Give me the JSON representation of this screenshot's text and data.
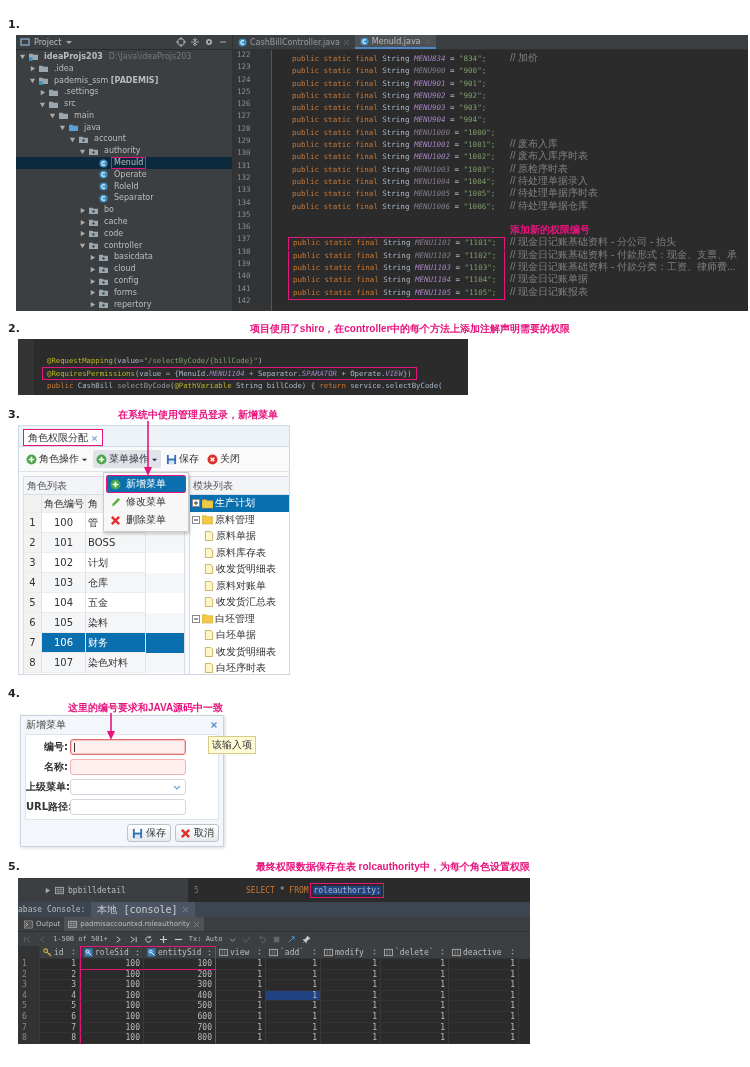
{
  "step_1": {
    "label": "1.",
    "project_panel": {
      "title": "Project",
      "tree": [
        {
          "label": "ideaProjs203",
          "path": "D:\\Java\\ideaProjs203",
          "kind": "project",
          "expanded": true,
          "selected": false,
          "children": [
            {
              "label": ".idea",
              "kind": "folder",
              "expanded": false,
              "selected": false
            },
            {
              "label": "pademis_ssm **[PADEMIS]**",
              "kind": "project",
              "expanded": true,
              "selected": false,
              "children": [
                {
                  "label": ".settings",
                  "kind": "folder",
                  "expanded": false,
                  "selected": false
                },
                {
                  "label": "src",
                  "kind": "folder",
                  "expanded": true,
                  "selected": false,
                  "children": [
                    {
                      "label": "main",
                      "kind": "folder",
                      "expanded": true,
                      "selected": false,
                      "children": [
                        {
                          "label": "java",
                          "kind": "source",
                          "expanded": true,
                          "selected": false,
                          "children": [
                            {
                              "label": "account",
                              "kind": "package",
                              "expanded": true,
                              "selected": false,
                              "children": [
                                {
                                  "label": "authority",
                                  "kind": "package",
                                  "expanded": true,
                                  "selected": false,
                                  "children": [
                                    {
                                      "label": "MenuId",
                                      "kind": "class",
                                      "selected": true,
                                      "highlighted": true
                                    },
                                    {
                                      "label": "Operate",
                                      "kind": "class",
                                      "selected": false,
                                      "highlighted": false
                                    },
                                    {
                                      "label": "RoleId",
                                      "kind": "class",
                                      "selected": false,
                                      "highlighted": false
                                    },
                                    {
                                      "label": "Separator",
                                      "kind": "class",
                                      "selected": false,
                                      "highlighted": false
                                    }
                                  ]
                                },
                                {
                                  "label": "bo",
                                  "kind": "package",
                                  "expanded": false,
                                  "selected": false
                                },
                                {
                                  "label": "cache",
                                  "kind": "package",
                                  "expanded": false,
                                  "selected": false
                                },
                                {
                                  "label": "code",
                                  "kind": "package",
                                  "expanded": false,
                                  "selected": false
                                },
                                {
                                  "label": "controller",
                                  "kind": "package",
                                  "expanded": true,
                                  "selected": false,
                                  "children": [
                                    {
                                      "label": "basicdata",
                                      "kind": "package",
                                      "expanded": false,
                                      "selected": false
                                    },
                                    {
                                      "label": "cloud",
                                      "kind": "package",
                                      "expanded": false,
                                      "selected": false
                                    },
                                    {
                                      "label": "config",
                                      "kind": "package",
                                      "expanded": false,
                                      "selected": false
                                    },
                                    {
                                      "label": "forms",
                                      "kind": "package",
                                      "expanded": false,
                                      "selected": false
                                    },
                                    {
                                      "label": "repertory",
                                      "kind": "package",
                                      "expanded": false,
                                      "selected": false
                                    }
                                  ]
                                }
                              ]
                            }
                          ]
                        }
                      ]
                    }
                  ]
                }
              ]
            }
          ]
        }
      ]
    },
    "editor": {
      "tabs": [
        {
          "label": "CashBillController.java",
          "selected": false
        },
        {
          "label": "MenuId.java",
          "selected": true
        }
      ],
      "lines": [
        {
          "number": "122",
          "boxed": false,
          "tokens": [
            {
              "kind": "kw",
              "text": "public static final "
            },
            {
              "kind": "ty",
              "text": "String "
            },
            {
              "kind": "co",
              "text": "MENU834"
            },
            {
              "kind": "pl",
              "text": " = "
            },
            {
              "kind": "st",
              "text": "\"834\";"
            }
          ],
          "comment": "//  加价"
        },
        {
          "number": "123",
          "boxed": false,
          "tokens": [
            {
              "kind": "kw",
              "text": "public static final "
            },
            {
              "kind": "ty",
              "text": "String "
            },
            {
              "kind": "cg",
              "text": "MENU900"
            },
            {
              "kind": "pl",
              "text": " = "
            },
            {
              "kind": "st",
              "text": "\"900\";"
            }
          ]
        },
        {
          "number": "124",
          "boxed": false,
          "tokens": [
            {
              "kind": "kw",
              "text": "public static final "
            },
            {
              "kind": "ty",
              "text": "String "
            },
            {
              "kind": "co",
              "text": "MENU901"
            },
            {
              "kind": "pl",
              "text": " = "
            },
            {
              "kind": "st",
              "text": "\"901\";"
            }
          ]
        },
        {
          "number": "125",
          "boxed": false,
          "tokens": [
            {
              "kind": "kw",
              "text": "public static final "
            },
            {
              "kind": "ty",
              "text": "String "
            },
            {
              "kind": "co",
              "text": "MENU902"
            },
            {
              "kind": "pl",
              "text": " = "
            },
            {
              "kind": "st",
              "text": "\"902\";"
            }
          ]
        },
        {
          "number": "126",
          "boxed": false,
          "tokens": [
            {
              "kind": "kw",
              "text": "public static final "
            },
            {
              "kind": "ty",
              "text": "String "
            },
            {
              "kind": "co",
              "text": "MENU903"
            },
            {
              "kind": "pl",
              "text": " = "
            },
            {
              "kind": "st",
              "text": "\"903\";"
            }
          ]
        },
        {
          "number": "127",
          "boxed": false,
          "tokens": [
            {
              "kind": "kw",
              "text": "public static final "
            },
            {
              "kind": "ty",
              "text": "String "
            },
            {
              "kind": "co",
              "text": "MENU904"
            },
            {
              "kind": "pl",
              "text": " = "
            },
            {
              "kind": "st",
              "text": "\"904\";"
            }
          ]
        },
        {
          "number": "128",
          "boxed": false,
          "tokens": [
            {
              "kind": "kw",
              "text": "public static final "
            },
            {
              "kind": "ty",
              "text": "String "
            },
            {
              "kind": "cg",
              "text": "MENU1000"
            },
            {
              "kind": "pl",
              "text": " = "
            },
            {
              "kind": "st",
              "text": "\"1000\";"
            }
          ]
        },
        {
          "number": "129",
          "boxed": false,
          "tokens": [
            {
              "kind": "kw",
              "text": "public static final "
            },
            {
              "kind": "ty",
              "text": "String "
            },
            {
              "kind": "co",
              "text": "MENU1001"
            },
            {
              "kind": "pl",
              "text": " = "
            },
            {
              "kind": "st",
              "text": "\"1001\";"
            }
          ],
          "comment": "// 废布入库"
        },
        {
          "number": "130",
          "boxed": false,
          "tokens": [
            {
              "kind": "kw",
              "text": "public static final "
            },
            {
              "kind": "ty",
              "text": "String "
            },
            {
              "kind": "co",
              "text": "MENU1002"
            },
            {
              "kind": "pl",
              "text": " = "
            },
            {
              "kind": "st",
              "text": "\"1002\";"
            }
          ],
          "comment": "// 废布入库序时表"
        },
        {
          "number": "131",
          "boxed": false,
          "tokens": [
            {
              "kind": "kw",
              "text": "public static final "
            },
            {
              "kind": "ty",
              "text": "String "
            },
            {
              "kind": "cg",
              "text": "MENU1003"
            },
            {
              "kind": "pl",
              "text": " = "
            },
            {
              "kind": "st",
              "text": "\"1003\";"
            }
          ],
          "comment": "// 原检序时表"
        },
        {
          "number": "132",
          "boxed": false,
          "tokens": [
            {
              "kind": "kw",
              "text": "public static final "
            },
            {
              "kind": "ty",
              "text": "String "
            },
            {
              "kind": "cg",
              "text": "MENU1004"
            },
            {
              "kind": "pl",
              "text": " = "
            },
            {
              "kind": "st",
              "text": "\"1004\";"
            }
          ],
          "comment": "// 待处理单据录入"
        },
        {
          "number": "133",
          "boxed": false,
          "tokens": [
            {
              "kind": "kw",
              "text": "public static final "
            },
            {
              "kind": "ty",
              "text": "String "
            },
            {
              "kind": "cg",
              "text": "MENU1005"
            },
            {
              "kind": "pl",
              "text": " = "
            },
            {
              "kind": "st",
              "text": "\"1005\";"
            }
          ],
          "comment": "// 待处理单据序时表"
        },
        {
          "number": "134",
          "boxed": false,
          "tokens": [
            {
              "kind": "kw",
              "text": "public static final "
            },
            {
              "kind": "ty",
              "text": "String "
            },
            {
              "kind": "cg",
              "text": "MENU1006"
            },
            {
              "kind": "pl",
              "text": " = "
            },
            {
              "kind": "st",
              "text": "\"1006\";"
            }
          ],
          "comment": "// 待处理单据仓库"
        },
        {
          "number": "135"
        },
        {
          "number": "136",
          "note": "添加新的权限编号"
        },
        {
          "number": "137",
          "boxed": true,
          "tokens": [
            {
              "kind": "kw",
              "text": "public static final "
            },
            {
              "kind": "ty",
              "text": "String "
            },
            {
              "kind": "cg",
              "text": "MENU1101"
            },
            {
              "kind": "pl",
              "text": " = "
            },
            {
              "kind": "st",
              "text": "\"1101\";"
            }
          ],
          "comment": "// 现金日记账基础资料 - 分公司 - 抬头"
        },
        {
          "number": "138",
          "boxed": true,
          "tokens": [
            {
              "kind": "kw",
              "text": "public static final "
            },
            {
              "kind": "ty",
              "text": "String "
            },
            {
              "kind": "cg",
              "text": "MENU1102"
            },
            {
              "kind": "pl",
              "text": " = "
            },
            {
              "kind": "st",
              "text": "\"1102\";"
            }
          ],
          "comment": "// 现金日记账基础资料 - 付款形式：现金、支票、承"
        },
        {
          "number": "139",
          "boxed": true,
          "tokens": [
            {
              "kind": "kw",
              "text": "public static final "
            },
            {
              "kind": "ty",
              "text": "String "
            },
            {
              "kind": "co",
              "text": "MENU1103"
            },
            {
              "kind": "pl",
              "text": " = "
            },
            {
              "kind": "st",
              "text": "\"1103\";"
            }
          ],
          "comment": "// 现金日记账基础资料 - 付款分类：工资、律师费..."
        },
        {
          "number": "140",
          "boxed": true,
          "tokens": [
            {
              "kind": "kw",
              "text": "public static final "
            },
            {
              "kind": "ty",
              "text": "String "
            },
            {
              "kind": "co",
              "text": "MENU1104"
            },
            {
              "kind": "pl",
              "text": " = "
            },
            {
              "kind": "st",
              "text": "\"1104\";"
            }
          ],
          "comment": "// 现金日记账单据"
        },
        {
          "number": "141",
          "boxed": true,
          "tokens": [
            {
              "kind": "kw",
              "text": "public static final "
            },
            {
              "kind": "ty",
              "text": "String "
            },
            {
              "kind": "co",
              "text": "MENU1105"
            },
            {
              "kind": "pl",
              "text": " = "
            },
            {
              "kind": "st",
              "text": "\"1105\";"
            }
          ],
          "comment": "// 现金日记账报表"
        },
        {
          "number": "142"
        }
      ]
    }
  },
  "step_2": {
    "label": "2.",
    "annotation": "项目使用了shiro，在controller中的每个方法上添加注解声明需要的权限",
    "lines": [
      {
        "boxed": false,
        "tokens": [
          {
            "kind": "an",
            "text": "@RequestMapping"
          },
          {
            "kind": "pl",
            "text": "(value="
          },
          {
            "kind": "st",
            "text": "\"/selectByCode/{billCode}\""
          },
          {
            "kind": "pl",
            "text": ")"
          }
        ]
      },
      {
        "boxed": true,
        "tokens": [
          {
            "kind": "an",
            "text": "@RequiresPermissions"
          },
          {
            "kind": "pl",
            "text": "(value = {MenuId."
          },
          {
            "kind": "co",
            "text": "MENU1104"
          },
          {
            "kind": "pl",
            "text": " + Separator."
          },
          {
            "kind": "co",
            "text": "SPARATOR"
          },
          {
            "kind": "pl",
            "text": " + Operate."
          },
          {
            "kind": "co",
            "text": "VIEW"
          },
          {
            "kind": "pl",
            "text": "})"
          }
        ]
      },
      {
        "boxed": false,
        "tokens": [
          {
            "kind": "kw",
            "text": "public "
          },
          {
            "kind": "pl",
            "text": "CashBill "
          },
          {
            "kind": "fn",
            "text": "selectByCode"
          },
          {
            "kind": "pl",
            "text": "("
          },
          {
            "kind": "an",
            "text": "@PathVariable"
          },
          {
            "kind": "pl",
            "text": " String billCode) { "
          },
          {
            "kind": "kw",
            "text": "return "
          },
          {
            "kind": "pl",
            "text": "service.selectByCode("
          }
        ]
      }
    ]
  },
  "step_3": {
    "label": "3.",
    "annotation": "在系统中使用管理员登录，新增菜单",
    "tab": {
      "label": "角色权限分配",
      "highlighted": true
    },
    "toolbar": [
      {
        "label": "角色操作",
        "kind": "add",
        "dropdown": true,
        "pressed": false
      },
      {
        "label": "菜单操作",
        "kind": "add",
        "dropdown": true,
        "pressed": true
      },
      {
        "label": "保存",
        "kind": "save",
        "dropdown": false,
        "pressed": false
      },
      {
        "label": "关闭",
        "kind": "close",
        "dropdown": false,
        "pressed": false
      }
    ],
    "menu": [
      {
        "label": "新增菜单",
        "kind": "add",
        "selected": true,
        "highlighted": true
      },
      {
        "label": "修改菜单",
        "kind": "edit",
        "selected": false,
        "highlighted": false
      },
      {
        "label": "删除菜单",
        "kind": "delete",
        "selected": false,
        "highlighted": false
      }
    ],
    "role_panel": {
      "title": "角色列表",
      "columns": [
        "角色编号",
        "角"
      ],
      "rows": [
        {
          "number": "1",
          "code": "100",
          "name": "管",
          "selected": false
        },
        {
          "number": "2",
          "code": "101",
          "name": "BOSS",
          "selected": false
        },
        {
          "number": "3",
          "code": "102",
          "name": "计划",
          "selected": false
        },
        {
          "number": "4",
          "code": "103",
          "name": "仓库",
          "selected": false
        },
        {
          "number": "5",
          "code": "104",
          "name": "五金",
          "selected": false
        },
        {
          "number": "6",
          "code": "105",
          "name": "染料",
          "selected": false
        },
        {
          "number": "7",
          "code": "106",
          "name": "财务",
          "selected": true
        },
        {
          "number": "8",
          "code": "107",
          "name": "染色对料",
          "selected": false
        }
      ]
    },
    "module_panel": {
      "title": "模块列表",
      "tree": [
        {
          "label": "生产计划",
          "expanded": false,
          "selected": true
        },
        {
          "label": "原料管理",
          "expanded": true,
          "selected": false,
          "children": [
            {
              "label": "原料单据",
              "selected": false
            },
            {
              "label": "原料库存表",
              "selected": false
            },
            {
              "label": "收发货明细表",
              "selected": false
            },
            {
              "label": "原料对账单",
              "selected": false
            },
            {
              "label": "收发货汇总表",
              "selected": false
            }
          ]
        },
        {
          "label": "白坯管理",
          "expanded": true,
          "selected": false,
          "children": [
            {
              "label": "白坯单据",
              "selected": false
            },
            {
              "label": "收发货明细表",
              "selected": false
            },
            {
              "label": "白坯序时表",
              "selected": false
            }
          ]
        }
      ]
    }
  },
  "step_4": {
    "label": "4.",
    "annotation": "这里的编号要求和JAVA源码中一致",
    "dialog": {
      "title": "新增菜单",
      "fields": [
        {
          "label": "编号:",
          "kind": "text",
          "invalid": true,
          "focused": true
        },
        {
          "label": "名称:",
          "kind": "text",
          "invalid": true,
          "focused": false
        },
        {
          "label": "上级菜单:",
          "kind": "combo",
          "invalid": false,
          "focused": false
        },
        {
          "label": "URL路径:",
          "kind": "text",
          "invalid": false,
          "focused": false
        }
      ],
      "tooltip": "该输入项",
      "buttons": [
        {
          "label": "保存",
          "kind": "save"
        },
        {
          "label": "取消",
          "kind": "cancel"
        }
      ]
    }
  },
  "step_5": {
    "label": "5.",
    "annotation": "最终权限数据保存在表 rolcauthority中，为每个角色设置权限",
    "schema_item": "bpbilldetail",
    "query": {
      "number": "5",
      "tokens": [
        {
          "kind": "kw",
          "text": "SELECT"
        },
        {
          "kind": "pl",
          "text": " * "
        },
        {
          "kind": "kw",
          "text": "FROM "
        },
        {
          "kind": "bx",
          "text": "roleauthority;"
        }
      ]
    },
    "console_label": "abase Console:",
    "console_tab": "本地 [console]",
    "result_tabs": [
      {
        "label": "Output",
        "kind": "output",
        "selected": false
      },
      {
        "label": "padmisaccountxd.roleauthority",
        "kind": "table",
        "selected": true
      }
    ],
    "pagination": "1-500 of 501+",
    "transaction": "Tx: Auto",
    "result_table": {
      "columns": [
        {
          "label": "id",
          "kind": "primary",
          "highlighted": false
        },
        {
          "label": "roleSid",
          "kind": "foreign",
          "highlighted": true
        },
        {
          "label": "entitySid",
          "kind": "foreign",
          "highlighted": true
        },
        {
          "label": "view",
          "kind": "plain",
          "highlighted": false
        },
        {
          "label": "`add`",
          "kind": "plain",
          "highlighted": false
        },
        {
          "label": "modify",
          "kind": "plain",
          "highlighted": false
        },
        {
          "label": "`delete`",
          "kind": "plain",
          "highlighted": false
        },
        {
          "label": "deactive",
          "kind": "plain",
          "highlighted": false
        }
      ],
      "rows": [
        {
          "number": "1",
          "cells": [
            {
              "value": "1",
              "selected": false
            },
            {
              "value": "100",
              "selected": false
            },
            {
              "value": "100",
              "selected": false
            },
            {
              "value": "1",
              "selected": false
            },
            {
              "value": "1",
              "selected": false
            },
            {
              "value": "1",
              "selected": false
            },
            {
              "value": "1",
              "selected": false
            },
            {
              "value": "1",
              "selected": false
            }
          ]
        },
        {
          "number": "2",
          "cells": [
            {
              "value": "2",
              "selected": false
            },
            {
              "value": "100",
              "selected": false
            },
            {
              "value": "200",
              "selected": false
            },
            {
              "value": "1",
              "selected": false
            },
            {
              "value": "1",
              "selected": false
            },
            {
              "value": "1",
              "selected": false
            },
            {
              "value": "1",
              "selected": false
            },
            {
              "value": "1",
              "selected": false
            }
          ]
        },
        {
          "number": "3",
          "cells": [
            {
              "value": "3",
              "selected": false
            },
            {
              "value": "100",
              "selected": false
            },
            {
              "value": "300",
              "selected": false
            },
            {
              "value": "1",
              "selected": false
            },
            {
              "value": "1",
              "selected": false
            },
            {
              "value": "1",
              "selected": false
            },
            {
              "value": "1",
              "selected": false
            },
            {
              "value": "1",
              "selected": false
            }
          ]
        },
        {
          "number": "4",
          "cells": [
            {
              "value": "4",
              "selected": false
            },
            {
              "value": "100",
              "selected": false
            },
            {
              "value": "400",
              "selected": false
            },
            {
              "value": "1",
              "selected": false
            },
            {
              "value": "1",
              "selected": true
            },
            {
              "value": "1",
              "selected": false
            },
            {
              "value": "1",
              "selected": false
            },
            {
              "value": "1",
              "selected": false
            }
          ]
        },
        {
          "number": "5",
          "cells": [
            {
              "value": "5",
              "selected": false
            },
            {
              "value": "100",
              "selected": false
            },
            {
              "value": "500",
              "selected": false
            },
            {
              "value": "1",
              "selected": false
            },
            {
              "value": "1",
              "selected": false
            },
            {
              "value": "1",
              "selected": false
            },
            {
              "value": "1",
              "selected": false
            },
            {
              "value": "1",
              "selected": false
            }
          ]
        },
        {
          "number": "6",
          "cells": [
            {
              "value": "6",
              "selected": false
            },
            {
              "value": "100",
              "selected": false
            },
            {
              "value": "600",
              "selected": false
            },
            {
              "value": "1",
              "selected": false
            },
            {
              "value": "1",
              "selected": false
            },
            {
              "value": "1",
              "selected": false
            },
            {
              "value": "1",
              "selected": false
            },
            {
              "value": "1",
              "selected": false
            }
          ]
        },
        {
          "number": "7",
          "cells": [
            {
              "value": "7",
              "selected": false
            },
            {
              "value": "100",
              "selected": false
            },
            {
              "value": "700",
              "selected": false
            },
            {
              "value": "1",
              "selected": false
            },
            {
              "value": "1",
              "selected": false
            },
            {
              "value": "1",
              "selected": false
            },
            {
              "value": "1",
              "selected": false
            },
            {
              "value": "1",
              "selected": false
            }
          ]
        },
        {
          "number": "8",
          "cells": [
            {
              "value": "8",
              "selected": false
            },
            {
              "value": "100",
              "selected": false
            },
            {
              "value": "800",
              "selected": false
            },
            {
              "value": "1",
              "selected": false
            },
            {
              "value": "1",
              "selected": false
            },
            {
              "value": "1",
              "selected": false
            },
            {
              "value": "1",
              "selected": false
            },
            {
              "value": "1",
              "selected": false
            }
          ]
        }
      ]
    }
  }
}
